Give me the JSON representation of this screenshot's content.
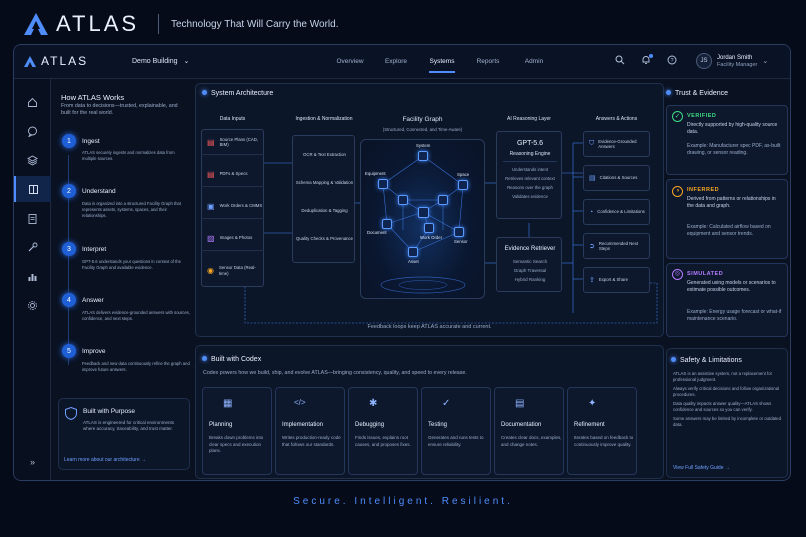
{
  "brand": {
    "name": "ATLAS",
    "tagline": "Technology That Will Carry the World."
  },
  "topnav": {
    "logo": "ATLAS",
    "workspace": "Demo Building",
    "links": [
      "Overview",
      "Explore",
      "Systems",
      "Reports",
      "Admin"
    ],
    "active": "Systems",
    "user": {
      "initials": "JS",
      "name": "Jordan Smith",
      "role": "Facility Manager"
    }
  },
  "sidebar": {
    "icons": [
      "home-icon",
      "chat-icon",
      "layers-icon",
      "book-icon",
      "clipboard-icon",
      "wrench-icon",
      "bar-chart-icon",
      "gear-icon"
    ],
    "active": "book-icon",
    "collapse_glyph": "»"
  },
  "how": {
    "title": "How ATLAS Works",
    "subtitle": "From data to decisions—trusted, explainable, and built for the real world.",
    "steps": [
      {
        "num": "1",
        "title": "Ingest",
        "desc": "ATLAS securely ingests and normalizes data from multiple sources."
      },
      {
        "num": "2",
        "title": "Understand",
        "desc": "Data is organized into a structured Facility Graph that represents assets, systems, spaces, and their relationships."
      },
      {
        "num": "3",
        "title": "Interpret",
        "desc": "GPT-5.6 understands your questions in context of the Facility Graph and available evidence."
      },
      {
        "num": "4",
        "title": "Answer",
        "desc": "ATLAS delivers evidence-grounded answers with sources, confidence, and next steps."
      },
      {
        "num": "5",
        "title": "Improve",
        "desc": "Feedback and new data continuously refine the graph and improve future answers."
      }
    ],
    "purpose": {
      "title": "Built with Purpose",
      "desc": "ATLAS is engineered for critical environments where accuracy, traceability, and trust matter.",
      "link": "Learn more about our architecture  →"
    }
  },
  "arch": {
    "title": "System Architecture",
    "col_inputs": "Data Inputs",
    "col_ingest": "Ingestion & Normalization",
    "col_graph": "Facility Graph",
    "col_graph_sub": "(Structured, Connected, and Time-Aware)",
    "col_ai": "AI Reasoning Layer",
    "col_answers": "Answers & Actions",
    "inputs": [
      "Source Plans (CAD, BIM)",
      "PDFs & Specs",
      "Work Orders & CMMS",
      "Images & Photos",
      "Sensor Data (Real-time)"
    ],
    "ingest": [
      "OCR & Text Extraction",
      "Schema Mapping & Validation",
      "Deduplication & Tagging",
      "Quality Checks & Provenance"
    ],
    "graph_nodes": [
      "System",
      "Equipment",
      "Space",
      "Document",
      "Work Order",
      "Sensor",
      "Asset"
    ],
    "model": {
      "name": "GPT-5.6",
      "sub": "Reasoning Engine",
      "items": [
        "Understands intent",
        "Retrieves relevant context",
        "Reasons over the graph",
        "Validates evidence"
      ]
    },
    "retriever": {
      "name": "Evidence Retriever",
      "items": [
        "Semantic Search",
        "Graph Traversal",
        "Hybrid Ranking"
      ]
    },
    "answers": [
      "Evidence-Grounded Answers",
      "Citations & Sources",
      "Confidence & Limitations",
      "Recommended Next Steps",
      "Export & Share"
    ],
    "feedback": "Feedback loops keep ATLAS accurate and current."
  },
  "codex": {
    "title": "Built with Codex",
    "subtitle": "Codex powers how we build, ship, and evolve ATLAS—bringing consistency, quality, and speed to every release.",
    "cards": [
      {
        "title": "Planning",
        "desc": "Breaks down problems into clear specs and execution plans.",
        "icon": "calendar-icon",
        "glyph": "▦"
      },
      {
        "title": "Implementation",
        "desc": "Writes production-ready code that follows our standards.",
        "icon": "code-icon",
        "glyph": "</>"
      },
      {
        "title": "Debugging",
        "desc": "Finds issues, explains root causes, and proposes fixes.",
        "icon": "bug-icon",
        "glyph": "✱"
      },
      {
        "title": "Testing",
        "desc": "Generates and runs tests to ensure reliability.",
        "icon": "check-circle-icon",
        "glyph": "✓"
      },
      {
        "title": "Documentation",
        "desc": "Creates clear docs, examples, and change notes.",
        "icon": "document-icon",
        "glyph": "▤"
      },
      {
        "title": "Refinement",
        "desc": "Iterates based on feedback to continuously improve quality.",
        "icon": "sparkle-icon",
        "glyph": "✦"
      }
    ]
  },
  "trust": {
    "title": "Trust & Evidence",
    "cards": [
      {
        "tag": "VERIFIED",
        "color": "#3ddc84",
        "body": "Directly supported by high-quality source data.",
        "example": "Example: Manufacturer spec PDF, as-built drawing, or sensor reading."
      },
      {
        "tag": "INFERRED",
        "color": "#f5a623",
        "body": "Derived from patterns or relationships in the data and graph.",
        "example": "Example: Calculated airflow based on equipment and sensor trends."
      },
      {
        "tag": "SIMULATED",
        "color": "#b57bff",
        "body": "Generated using models or scenarios to estimate possible outcomes.",
        "example": "Example: Energy usage forecast or what-if maintenance scenario."
      }
    ]
  },
  "safety": {
    "title": "Safety & Limitations",
    "items": [
      "ATLAS is an assistive system, not a replacement for professional judgment.",
      "Always verify critical decisions and follow organizational procedures.",
      "Data quality impacts answer quality—ATLAS shows confidence and sources so you can verify.",
      "Some answers may be limited by incomplete or outdated data."
    ],
    "link": "View Full Safety Guide  →"
  },
  "footer_tagline": "Secure.  Intelligent.  Resilient."
}
